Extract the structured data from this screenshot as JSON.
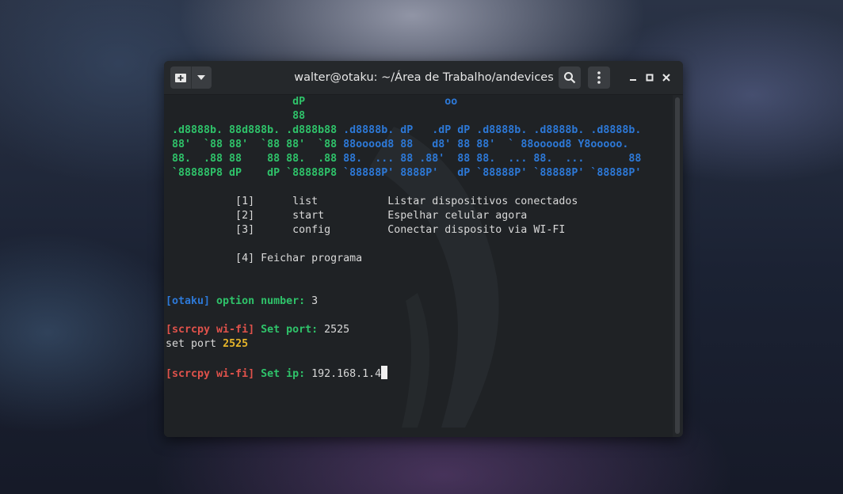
{
  "window": {
    "title": "walter@otaku: ~/Área de Trabalho/andevices"
  },
  "icons": {
    "new_tab": "new-tab-icon",
    "dropdown": "chevron-down-icon",
    "search": "search-icon",
    "menu": "kebab-menu-icon",
    "minimize": "minimize-icon",
    "maximize": "maximize-icon",
    "close": "close-icon"
  },
  "colors": {
    "green": "#2fc36a",
    "blue": "#2d79d8",
    "red": "#e0524b",
    "yellow": "#e6b52a",
    "background": "#1f2225"
  },
  "banner": {
    "row1_green": "                    dP",
    "row1_blue": "                      oo",
    "row2_green": "                    88",
    "row3_green": " .d8888b. 88d888b. .d888b88",
    "row3_blue": " .d8888b. dP   .dP dP .d8888b. .d8888b. .d8888b.",
    "row4_green": " 88'  `88 88'  `88 88'  `88",
    "row4_blue": " 88ooood8 88   d8' 88 88'  ` 88ooood8 Y8ooooo.",
    "row5_green": " 88.  .88 88    88 88.  .88",
    "row5_blue": " 88.  ... 88 .88'  88 88.  ... 88.  ...       88",
    "row6_green": " `88888P8 dP    dP `88888P8",
    "row6_blue": " `88888P' 8888P'   dP `88888P' `88888P' `88888P'"
  },
  "menu": {
    "item1": "           [1]      list           Listar dispositivos conectados",
    "item2": "           [2]      start          Espelhar celular agora",
    "item3": "           [3]      config         Conectar disposito via WI-FI",
    "item4": "           [4] Feichar programa"
  },
  "session": {
    "prompt1_tag": "[otaku]",
    "prompt1_label": " option number:",
    "prompt1_value": " 3",
    "prompt2_tag": "[scrcpy wi-fi]",
    "prompt2_label": " Set port:",
    "prompt2_value": " 2525",
    "echo_text": "set port ",
    "echo_value": "2525",
    "prompt3_tag": "[scrcpy wi-fi]",
    "prompt3_label": " Set ip:",
    "prompt3_value": " 192.168.1.4"
  }
}
